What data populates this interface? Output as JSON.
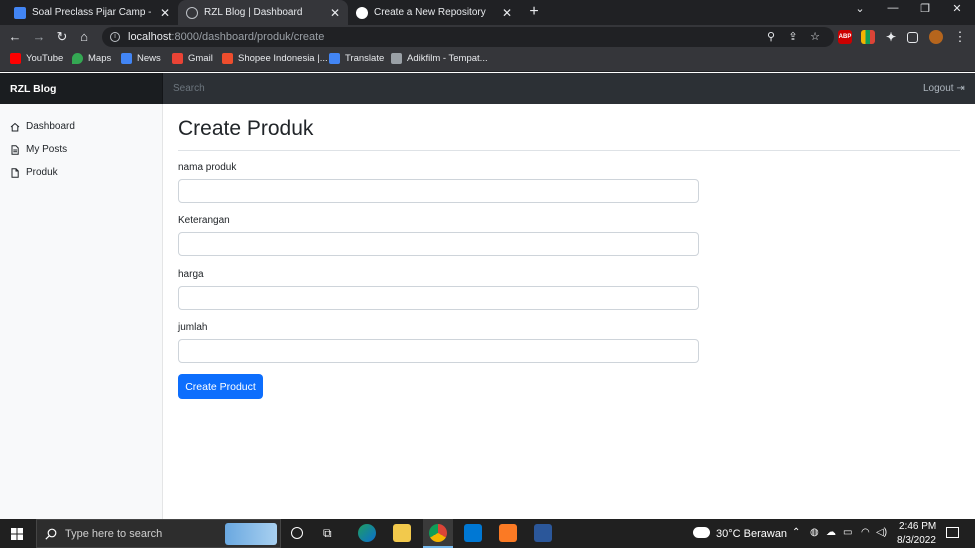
{
  "browser": {
    "tabs": [
      {
        "label": "Soal Preclass Pijar Camp - Google",
        "icon": "google-docs-icon",
        "color": "#4285f4"
      },
      {
        "label": "RZL Blog | Dashboard",
        "icon": "globe-icon",
        "color": "#bdc1c6"
      },
      {
        "label": "Create a New Repository",
        "icon": "github-icon",
        "color": "#ffffff"
      }
    ],
    "url": {
      "host": "localhost",
      "path": ":8000/dashboard/produk/create"
    },
    "bookmarks": [
      {
        "label": "YouTube",
        "color": "#ff0000"
      },
      {
        "label": "Maps",
        "color": "#34a853"
      },
      {
        "label": "News",
        "color": "#4285f4"
      },
      {
        "label": "Gmail",
        "color": "#ea4335"
      },
      {
        "label": "Shopee Indonesia |...",
        "color": "#ee4d2d"
      },
      {
        "label": "Translate",
        "color": "#4285f4"
      },
      {
        "label": "Adikfilm - Tempat...",
        "color": "#9aa0a6"
      }
    ],
    "extensions": {
      "abp": "ABP"
    }
  },
  "navbar": {
    "brand": "RZL Blog",
    "search_placeholder": "Search",
    "logout": "Logout"
  },
  "sidebar": {
    "items": [
      {
        "label": "Dashboard",
        "icon": "home-icon"
      },
      {
        "label": "My Posts",
        "icon": "file-text-icon"
      },
      {
        "label": "Produk",
        "icon": "file-icon"
      }
    ]
  },
  "main": {
    "title": "Create Produk",
    "fields": [
      {
        "label": "nama produk",
        "value": ""
      },
      {
        "label": "Keterangan",
        "value": ""
      },
      {
        "label": "harga",
        "value": ""
      },
      {
        "label": "jumlah",
        "value": ""
      }
    ],
    "submit": "Create Product",
    "accent": "#0d6efd"
  },
  "taskbar": {
    "search_placeholder": "Type here to search",
    "weather": "30°C  Berawan",
    "time": "2:46 PM",
    "date": "8/3/2022"
  }
}
